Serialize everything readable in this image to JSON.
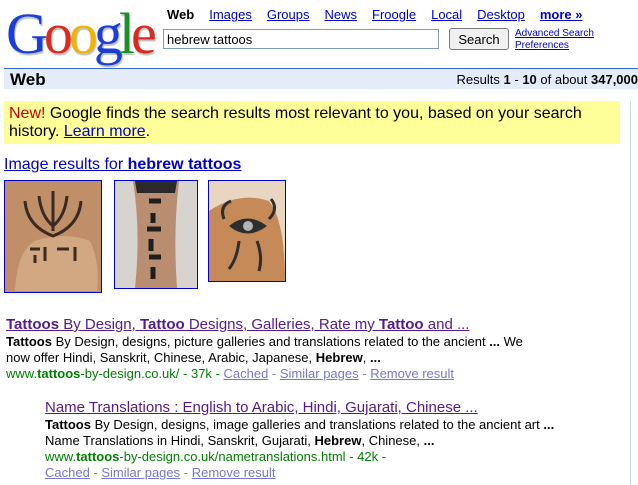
{
  "logo": {
    "letters": [
      "G",
      "o",
      "o",
      "g",
      "l",
      "e"
    ]
  },
  "tabs": {
    "current": "Web",
    "links": [
      "Images",
      "Groups",
      "News",
      "Froogle",
      "Local",
      "Desktop"
    ],
    "more": "more »"
  },
  "search": {
    "value": "hebrew tattoos",
    "button": "Search"
  },
  "advanced": {
    "advanced_search": "Advanced Search",
    "preferences": "Preferences"
  },
  "results_bar": {
    "heading": "Web",
    "prefix": "Results ",
    "range_start": "1",
    "dash": " - ",
    "range_end": "10",
    "of_about": " of about ",
    "total": "347,000"
  },
  "notice": {
    "new": "New!",
    "text": " Google finds the search results most relevant to you, based on your search history.",
    "learn_more": "Learn more",
    "end": "."
  },
  "image_results": {
    "prefix": "Image results for ",
    "query": "hebrew tattoos"
  },
  "results": [
    {
      "title_parts": [
        "Tattoos",
        " By Design, ",
        "Tattoo",
        " Designs, Galleries, Rate my ",
        "Tattoo",
        " and ..."
      ],
      "snippet_line1": [
        "Tattoos",
        " By Design, designs, picture galleries and translations related to the ancient ",
        "...",
        " We"
      ],
      "snippet_line2": [
        "now offer Hindi, Sanskrit, Chinese, Arabic, Japanese, ",
        "Hebrew",
        ", ",
        "..."
      ],
      "url_parts": [
        "www.",
        "tattoos",
        "-by-design.co.uk/"
      ],
      "size": " - 37k - ",
      "cached": "Cached",
      "sep": " - ",
      "similar": "Similar pages",
      "remove": "Remove result"
    },
    {
      "title": "Name Translations : English to Arabic, Hindi, Gujarati, Chinese ...",
      "snippet_line1": [
        "Tattoos",
        " By Design, designs, image galleries and translations related to the ancient art ",
        "..."
      ],
      "snippet_line2": [
        "Name Translations in Hindi, Sanskrit, Gujarati, ",
        "Hebrew",
        ", Chinese, ",
        "..."
      ],
      "url_parts": [
        "www.",
        "tattoos",
        "-by-design.co.uk/nametranslations.html"
      ],
      "size": " - 42k -",
      "cached": "Cached",
      "sep": " - ",
      "similar": "Similar pages",
      "remove": "Remove result"
    }
  ],
  "colors": {
    "link": "#0000cc",
    "visited": "#551a8b",
    "url_green": "#008000",
    "notice_bg": "#ffff99",
    "bar_bg": "#e5ecf9"
  }
}
